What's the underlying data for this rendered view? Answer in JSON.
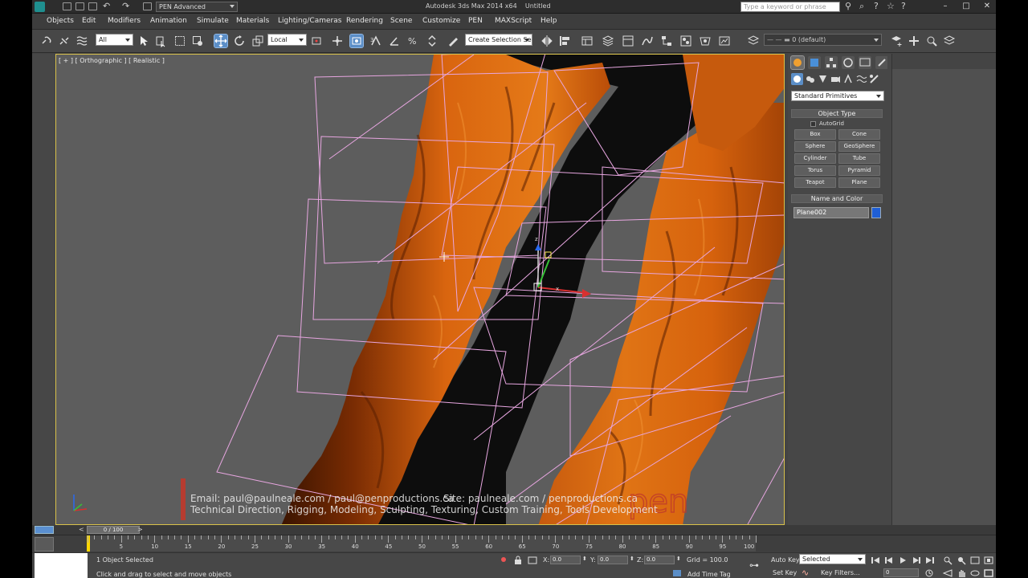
{
  "window": {
    "title": "Autodesk 3ds Max 2014 x64",
    "doc_title": "Untitled",
    "workspace": "PEN Advanced",
    "search_placeholder": "Type a keyword or phrase"
  },
  "menu": [
    "Objects",
    "Edit",
    "Modifiers",
    "Animation",
    "Simulate",
    "Materials",
    "Lighting/Cameras",
    "Rendering",
    "Scene",
    "Customize",
    "PEN",
    "MAXScript",
    "Help"
  ],
  "toolbar": {
    "selection_filter": "All",
    "ref_coord": "Local",
    "named_selection": "Create Selection Se",
    "layer": "0 (default)"
  },
  "viewport": {
    "label": "[ + ] [ Orthographic ] [ Realistic ]",
    "watermark": {
      "line1_email": "Email: paul@paulneale.com / paul@penproductions.ca",
      "line1_site": "Site: paulneale.com / penproductions.ca",
      "line2": "Technical Direction, Rigging, Modeling, Sculpting, Texturing, Custom Training, Tools Development",
      "logo": "pen"
    }
  },
  "command_panel": {
    "category": "Standard Primitives",
    "object_type_title": "Object Type",
    "autogrid_label": "AutoGrid",
    "buttons": [
      "Box",
      "Cone",
      "Sphere",
      "GeoSphere",
      "Cylinder",
      "Tube",
      "Torus",
      "Pyramid",
      "Teapot",
      "Plane"
    ],
    "name_color_title": "Name and Color",
    "object_name": "Plane002",
    "object_color": "#1f5fd6"
  },
  "timeline": {
    "frame_display": "0 / 100",
    "ticks": [
      "5",
      "10",
      "15",
      "20",
      "25",
      "30",
      "35",
      "40",
      "45",
      "50",
      "55",
      "60",
      "65",
      "70",
      "75",
      "80",
      "85",
      "90",
      "95",
      "100"
    ]
  },
  "status": {
    "selection": "1 Object Selected",
    "prompt": "Click and drag to select and move objects",
    "x_label": "X:",
    "x": "0.0",
    "y_label": "Y:",
    "y": "0.0",
    "z_label": "Z:",
    "z": "0.0",
    "grid": "Grid = 100.0",
    "add_time_tag": "Add Time Tag",
    "auto_key": "Auto Key",
    "set_key": "Set Key",
    "key_mode": "Selected",
    "key_filters": "Key Filters...",
    "current_frame": "0"
  },
  "colors": {
    "rock": "#d9650f",
    "rock_dark": "#5a1f02",
    "wire": "#e7a6e0",
    "viewport_bg": "#5d5d5d",
    "viewport_border": "#d8c14a",
    "accent": "#5b8ec7"
  }
}
